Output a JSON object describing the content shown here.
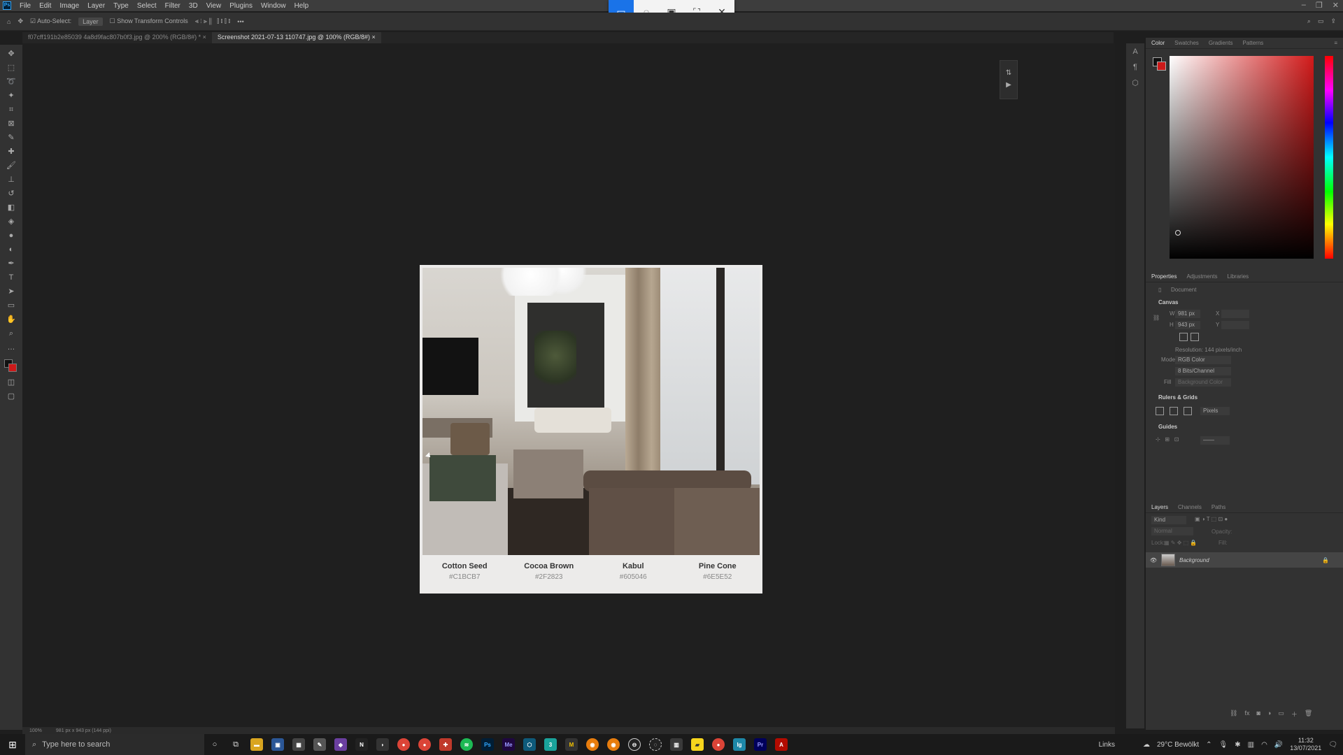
{
  "menubar": {
    "items": [
      "File",
      "Edit",
      "Image",
      "Layer",
      "Type",
      "Select",
      "Filter",
      "3D",
      "View",
      "Plugins",
      "Window",
      "Help"
    ]
  },
  "snip": {
    "icons": [
      "rect-snip-icon",
      "freeform-snip-icon",
      "window-snip-icon",
      "fullscreen-snip-icon",
      "close-icon"
    ]
  },
  "options": {
    "auto_select": "Auto-Select:",
    "layer_dropdown": "Layer",
    "transform": "Show Transform Controls",
    "more": "•••"
  },
  "tabs": [
    {
      "label": "f07cff191b2e85039 4a8d9fac807b0f3.jpg @ 200% (RGB/8#) *"
    },
    {
      "label": "Screenshot 2021-07-13 110747.jpg @ 100% (RGB/8#)"
    }
  ],
  "artboard": {
    "swatches": [
      {
        "name": "Cotton Seed",
        "hex": "#C1BCB7"
      },
      {
        "name": "Cocoa Brown",
        "hex": "#2F2823"
      },
      {
        "name": "Kabul",
        "hex": "#605046"
      },
      {
        "name": "Pine Cone",
        "hex": "#6E5E52"
      }
    ]
  },
  "color_panel": {
    "tabs": [
      "Color",
      "Swatches",
      "Gradients",
      "Patterns"
    ]
  },
  "properties_panel": {
    "tabs": [
      "Properties",
      "Adjustments",
      "Libraries"
    ],
    "doc_label": "Document",
    "canvas_title": "Canvas",
    "w_label": "W",
    "w_value": "981 px",
    "h_label": "H",
    "h_value": "943 px",
    "x_label": "X",
    "y_label": "Y",
    "resolution": "Resolution: 144 pixels/inch",
    "mode_label": "Mode",
    "mode_value": "RGB Color",
    "bits_value": "8 Bits/Channel",
    "fill_label": "Fill",
    "fill_value": "Background Color",
    "rulers_title": "Rulers & Grids",
    "rulers_unit": "Pixels",
    "guides_title": "Guides"
  },
  "layers_panel": {
    "tabs": [
      "Layers",
      "Channels",
      "Paths"
    ],
    "search_placeholder": "Kind",
    "blend": "Normal",
    "opacity_label": "Opacity:",
    "lock_label": "Lock:",
    "fill_label": "Fill:",
    "layer_name": "Background"
  },
  "statusbar": {
    "zoom": "100%",
    "doc_size": "981 px x 943 px (144 ppi)"
  },
  "taskbar": {
    "search_placeholder": "Type here to search",
    "tray_links": "Links",
    "weather": "29°C  Bewölkt",
    "time": "11:32",
    "date": "13/07/2021"
  }
}
